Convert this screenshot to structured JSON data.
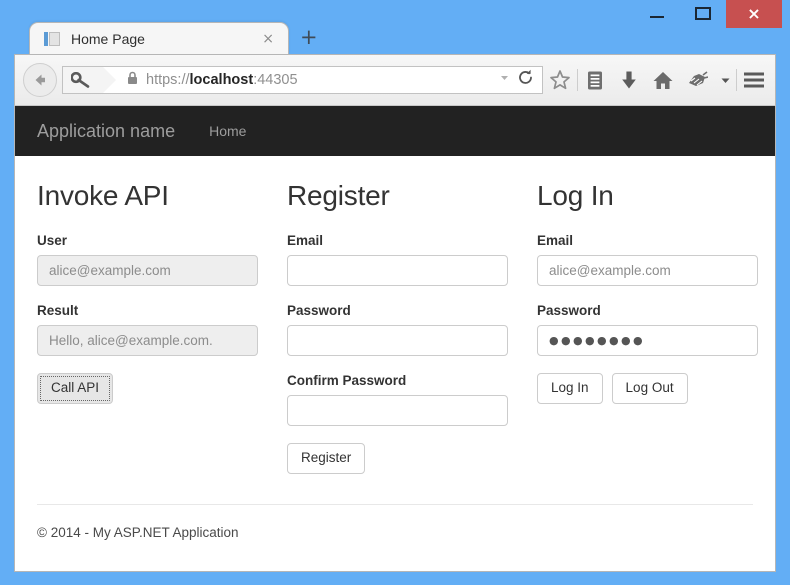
{
  "window": {
    "minimize_label": "minimize",
    "maximize_label": "maximize",
    "close_label": "×",
    "frame_color": "#63aef5"
  },
  "browser": {
    "tab": {
      "title": "Home Page",
      "close_label": "×",
      "favicon": "document-icon"
    },
    "new_tab_label": "+",
    "url": {
      "scheme": "https://",
      "host": "localhost",
      "port": ":44305",
      "full": "https://localhost:44305"
    },
    "icons": {
      "back": "back-arrow-icon",
      "identity": "key-icon",
      "lock": "padlock-icon",
      "dropmarker": "chevron-down-icon",
      "reload": "reload-icon",
      "bookmark": "star-icon",
      "reader": "library-icon",
      "downloads": "download-arrow-icon",
      "home": "home-icon",
      "addon": "fox-icon",
      "overflow": "chevron-down-icon",
      "menu": "hamburger-menu-icon"
    }
  },
  "navbar": {
    "brand": "Application name",
    "links": [
      {
        "label": "Home"
      }
    ],
    "background": "#222222",
    "text_color": "#9d9d9d"
  },
  "columns": [
    {
      "id": "invoke-api",
      "heading": "Invoke API",
      "fields": [
        {
          "id": "user",
          "label": "User",
          "value": "alice@example.com",
          "placeholder": "",
          "disabled": true,
          "masked": false
        },
        {
          "id": "result",
          "label": "Result",
          "value": "Hello, alice@example.com.",
          "placeholder": "",
          "disabled": true,
          "masked": false
        }
      ],
      "buttons": [
        {
          "id": "call-api",
          "label": "Call API",
          "focused": true
        }
      ]
    },
    {
      "id": "register",
      "heading": "Register",
      "fields": [
        {
          "id": "register-email",
          "label": "Email",
          "value": "",
          "placeholder": "",
          "disabled": false,
          "masked": false
        },
        {
          "id": "register-password",
          "label": "Password",
          "value": "",
          "placeholder": "",
          "disabled": false,
          "masked": true
        },
        {
          "id": "register-confirm-password",
          "label": "Confirm Password",
          "value": "",
          "placeholder": "",
          "disabled": false,
          "masked": true
        }
      ],
      "buttons": [
        {
          "id": "register",
          "label": "Register",
          "focused": false
        }
      ]
    },
    {
      "id": "log-in",
      "heading": "Log In",
      "fields": [
        {
          "id": "login-email",
          "label": "Email",
          "value": "alice@example.com",
          "placeholder": "",
          "disabled": false,
          "masked": false
        },
        {
          "id": "login-password",
          "label": "Password",
          "value": "●●●●●●●●",
          "placeholder": "",
          "disabled": false,
          "masked": true
        }
      ],
      "buttons": [
        {
          "id": "log-in",
          "label": "Log In",
          "focused": false
        },
        {
          "id": "log-out",
          "label": "Log Out",
          "focused": false
        }
      ]
    }
  ],
  "footer": {
    "text": "© 2014 - My ASP.NET Application"
  }
}
